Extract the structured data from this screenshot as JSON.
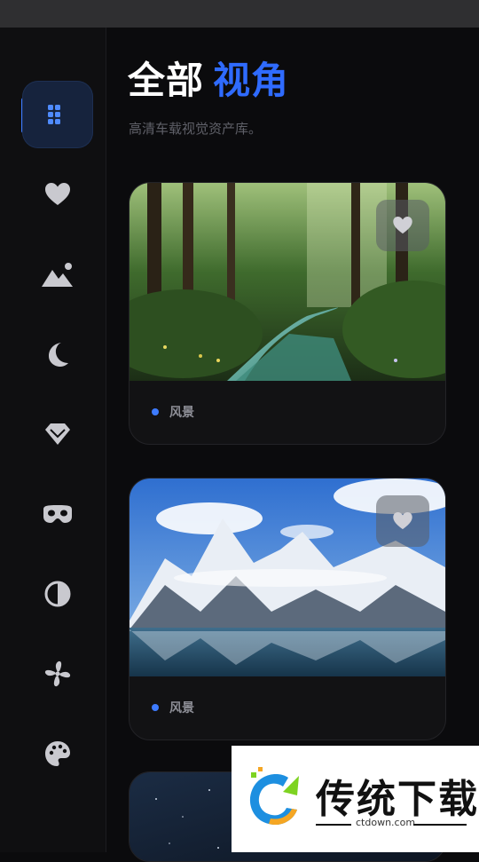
{
  "header": {
    "title_main": "全部",
    "title_accent": "视角",
    "subtitle": "高清车载视觉资产库。"
  },
  "sidebar": {
    "items": [
      {
        "icon": "grid-icon",
        "active": true
      },
      {
        "icon": "heart-icon",
        "active": false
      },
      {
        "icon": "mountain-icon",
        "active": false
      },
      {
        "icon": "moon-icon",
        "active": false
      },
      {
        "icon": "diamond-icon",
        "active": false
      },
      {
        "icon": "mask-icon",
        "active": false
      },
      {
        "icon": "contrast-icon",
        "active": false
      },
      {
        "icon": "fan-icon",
        "active": false
      },
      {
        "icon": "palette-icon",
        "active": false
      }
    ]
  },
  "cards": [
    {
      "category": "风景",
      "image": "forest-stream"
    },
    {
      "category": "风景",
      "image": "snow-mountain-lake"
    },
    {
      "image": "night-sky"
    }
  ],
  "watermark": {
    "title": "传统下载",
    "url": "ctdown.com"
  },
  "colors": {
    "accent": "#2f6bff",
    "background": "#0b0b0d",
    "icon_inactive": "#c9c9cf"
  }
}
